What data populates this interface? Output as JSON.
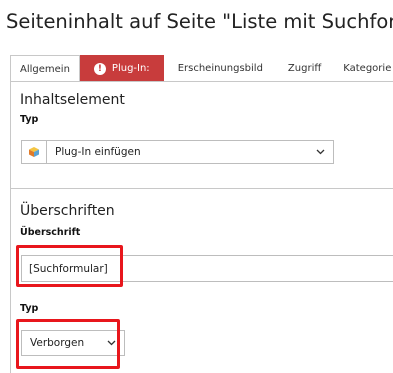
{
  "page": {
    "title": "Seiteninhalt auf Seite \"Liste mit Suchfor"
  },
  "tabs": [
    {
      "label": "Allgemein",
      "state": "active"
    },
    {
      "label": "Plug-In:",
      "state": "error"
    },
    {
      "label": "Erscheinungsbild",
      "state": "normal"
    },
    {
      "label": "Zugriff",
      "state": "normal"
    },
    {
      "label": "Kategorie",
      "state": "normal"
    }
  ],
  "content_element": {
    "section_title": "Inhaltselement",
    "type_label": "Typ",
    "type_value": "Plug-In einfügen",
    "type_icon": "cube-icon"
  },
  "headings": {
    "section_title": "Überschriften",
    "heading_label": "Überschrift",
    "heading_value": "[Suchformular]",
    "type_label": "Typ",
    "type_value": "Verborgen"
  },
  "colors": {
    "error_tab": "#c83c3c",
    "highlight": "#e8161c",
    "border": "#c8c8c8"
  }
}
